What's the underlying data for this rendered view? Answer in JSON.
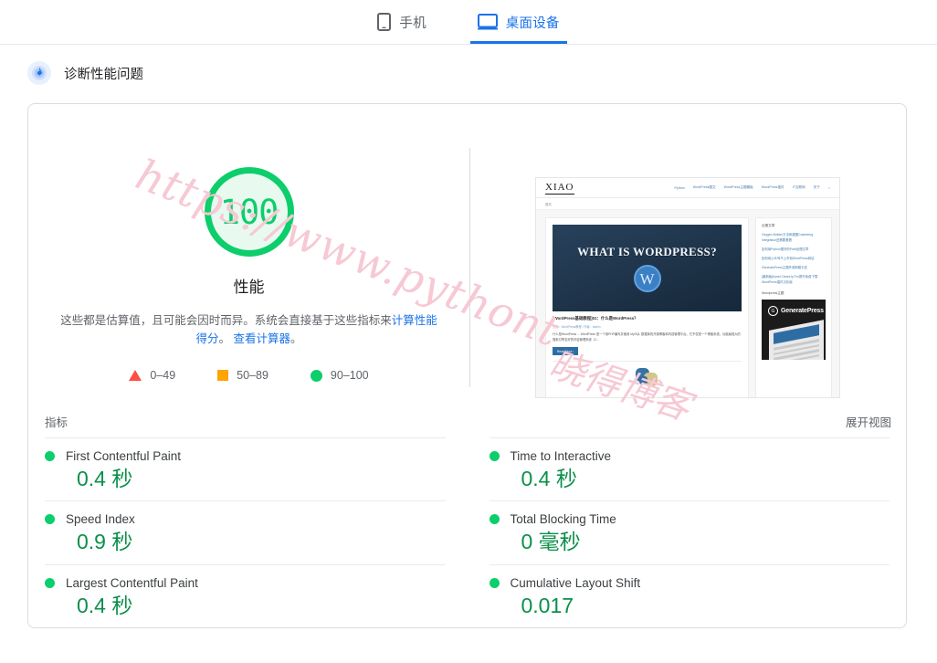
{
  "tabs": [
    {
      "label": "手机",
      "icon": "mobile-icon",
      "active": false
    },
    {
      "label": "桌面设备",
      "icon": "desktop-icon",
      "active": true
    }
  ],
  "diagnose": {
    "icon": "lighthouse-icon",
    "title": "诊断性能问题"
  },
  "score": {
    "value": "100",
    "caption": "性能",
    "description_part1": "这些都是估算值，且可能会因时而异。系统会直接基于这些指标来",
    "description_link1": "计算性能得分",
    "description_part2": "。 ",
    "description_link2": "查看计算器",
    "description_part3": "。",
    "color": "#0cce6b"
  },
  "legend": [
    {
      "shape": "triangle",
      "label": "0–49",
      "color": "#ff4e42"
    },
    {
      "shape": "square",
      "label": "50–89",
      "color": "#ffa400"
    },
    {
      "shape": "circle",
      "label": "90–100",
      "color": "#0cce6b"
    }
  ],
  "metrics_section": {
    "heading": "指标",
    "expand_label": "展开视图"
  },
  "metrics": [
    {
      "name": "First Contentful Paint",
      "value": "0.4 秒",
      "status": "good"
    },
    {
      "name": "Time to Interactive",
      "value": "0.4 秒",
      "status": "good"
    },
    {
      "name": "Speed Index",
      "value": "0.9 秒",
      "status": "good"
    },
    {
      "name": "Total Blocking Time",
      "value": "0 毫秒",
      "status": "good"
    },
    {
      "name": "Largest Contentful Paint",
      "value": "0.4 秒",
      "status": "good"
    },
    {
      "name": "Cumulative Layout Shift",
      "value": "0.017",
      "status": "good"
    }
  ],
  "thumbnail": {
    "logo": "XIAO",
    "nav": [
      "Python",
      "WordPress图文",
      "WordPress主题模板",
      "WordPress插件",
      "IT互联网",
      "关于"
    ],
    "breadcrumb": "首页",
    "hero_text": "WHAT IS WORDPRESS?",
    "post_title": "[WordPress基础教程]01：什么是WordPress？",
    "post_meta": "分类：WordPress教程 / 作者：admin",
    "post_excerpt": "什么是WordPress ... WordPress 是一个用PHP编写并使用 MySQL 数据库的开源博客和内容管理平台。它不仅是一个博客系统，功能最强大的搜索引擎友好的内容管理系统（C...",
    "read_more": "Read More ›",
    "sidebar_heading": "近期文章",
    "sidebar_links": [
      "Oxygen Builder方法和建图Gutenberg Integration还需要看看",
      "如何用Python更好的Path处理文章",
      "如何用公众号不上市到WordPress网站",
      "GeneratePress主题外观和模卡还",
      "[最新版]Asset CleanUp Pro提升免费下载 WordPress插件汉化版"
    ],
    "sidebar_heading2": "Wordpress主题",
    "ad_name": "GeneratePress"
  },
  "watermarks": {
    "line1": "https://www.pythont",
    "line2": "晓得博客"
  }
}
